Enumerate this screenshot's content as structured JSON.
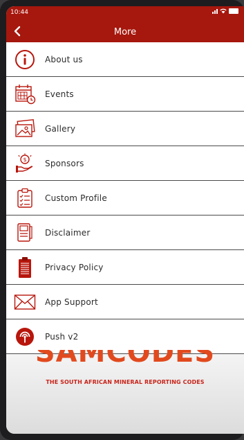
{
  "status_bar": {
    "time": "10:44"
  },
  "header": {
    "title": "More"
  },
  "menu": {
    "items": [
      {
        "label": "About us",
        "icon": "info-icon"
      },
      {
        "label": "Events",
        "icon": "calendar-clock-icon"
      },
      {
        "label": "Gallery",
        "icon": "gallery-icon"
      },
      {
        "label": "Sponsors",
        "icon": "sponsor-money-icon"
      },
      {
        "label": "Custom Profile",
        "icon": "clipboard-checklist-icon"
      },
      {
        "label": "Disclaimer",
        "icon": "document-icon"
      },
      {
        "label": "Privacy Policy",
        "icon": "privacy-clipboard-icon"
      },
      {
        "label": "App Support",
        "icon": "envelope-icon"
      },
      {
        "label": "Push v2",
        "icon": "push-broadcast-icon"
      }
    ]
  },
  "background": {
    "logo_text_a": "SAM",
    "logo_text_b": "CODES",
    "tagline": "THE SOUTH AFRICAN MINERAL REPORTING CODES"
  },
  "colors": {
    "header_bg": "#a6170d",
    "icon_red": "#b8160c",
    "logo_orange": "#e14a1e"
  }
}
